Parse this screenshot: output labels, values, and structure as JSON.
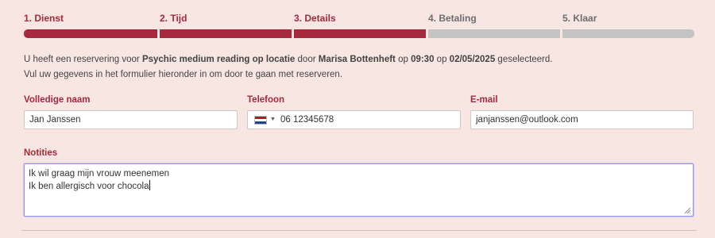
{
  "steps": [
    {
      "label": "1. Dienst",
      "state": "done"
    },
    {
      "label": "2. Tijd",
      "state": "done"
    },
    {
      "label": "3. Details",
      "state": "done"
    },
    {
      "label": "4. Betaling",
      "state": "todo"
    },
    {
      "label": "5. Klaar",
      "state": "todo"
    }
  ],
  "intro": {
    "prefix": "U heeft een reservering voor ",
    "service": "Psychic medium reading op locatie",
    "by": " door ",
    "provider": "Marisa Bottenheft",
    "at": " op ",
    "time": "09:30",
    "on": " op ",
    "date": "02/05/2025",
    "suffix": " geselecteerd.",
    "line2": "Vul uw gegevens in het formulier hieronder in om door te gaan met reserveren."
  },
  "form": {
    "name_label": "Volledige naam",
    "name_value": "Jan Janssen",
    "phone_label": "Telefoon",
    "phone_country": "Nederland",
    "phone_value": "06 12345678",
    "email_label": "E-mail",
    "email_value": "janjanssen@outlook.com",
    "notes_label": "Notities",
    "notes_line1": "Ik wil graag mijn vrouw meenemen",
    "notes_line2": "Ik ben allergisch voor chocola"
  },
  "colors": {
    "accent": "#a6293e",
    "progress_todo": "#c4c4c4",
    "background": "#f7e6e1",
    "focus_border": "#9b96e0"
  }
}
